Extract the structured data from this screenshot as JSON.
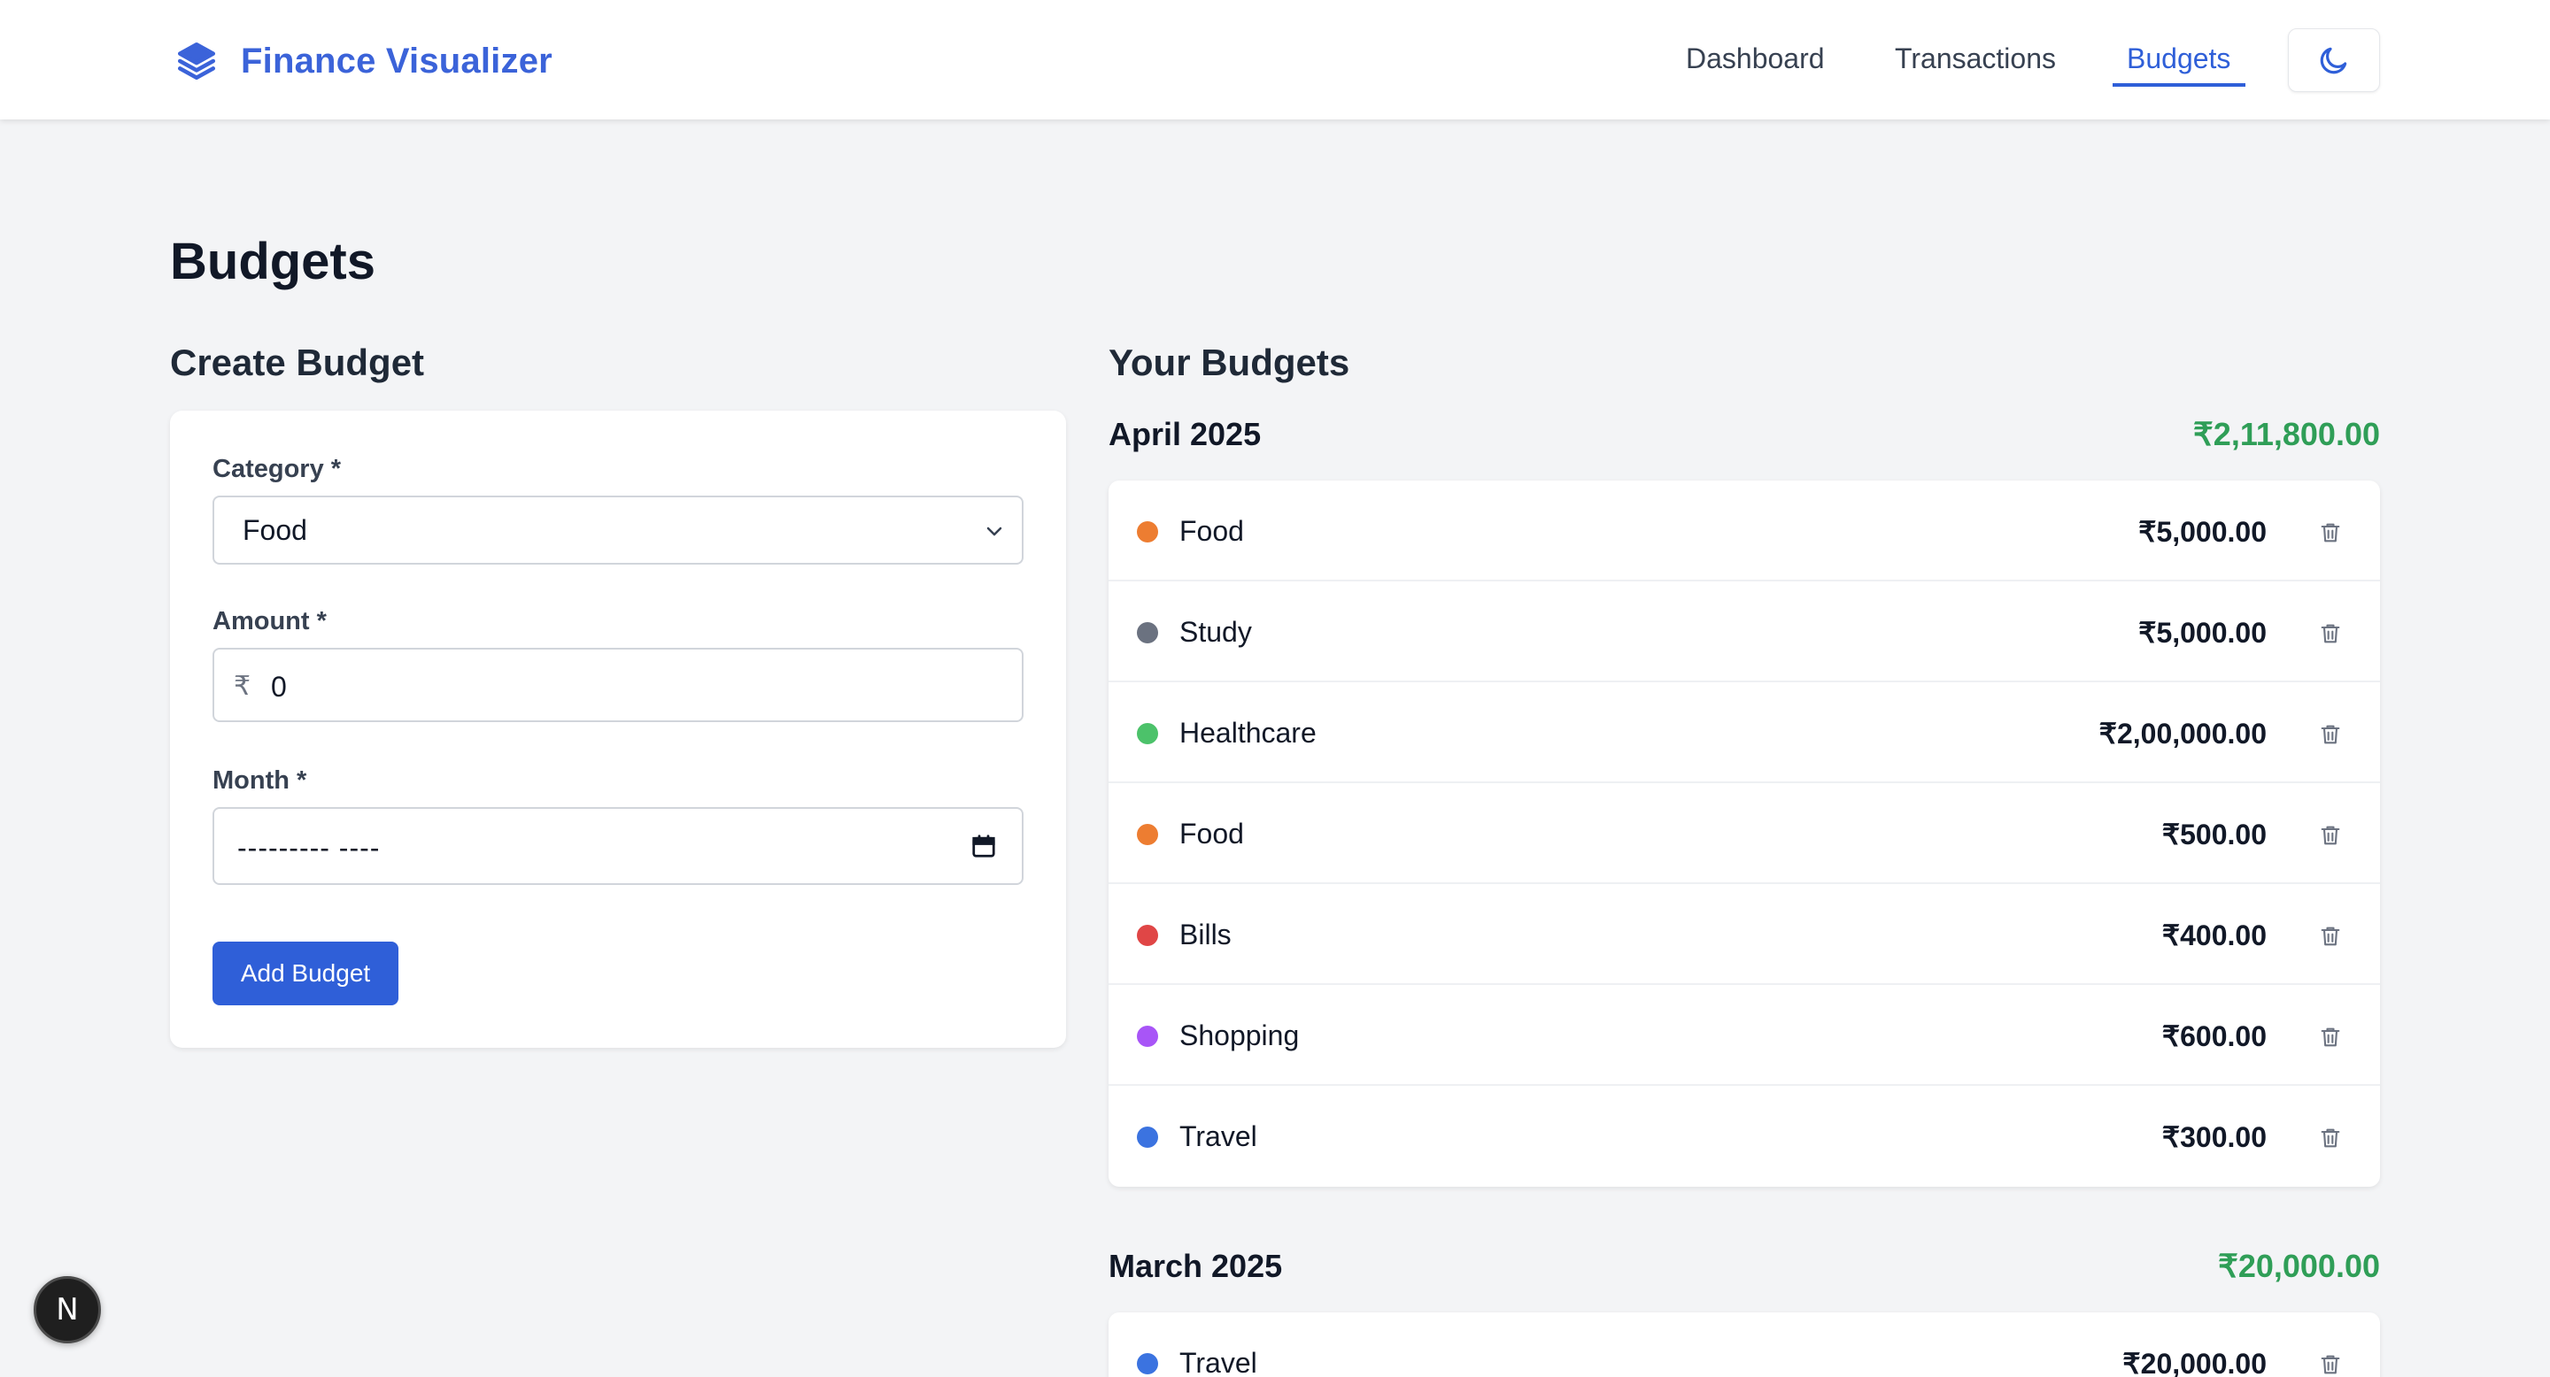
{
  "app": {
    "title": "Finance Visualizer",
    "accent_color": "#2f5fd8"
  },
  "nav": {
    "items": [
      {
        "label": "Dashboard",
        "active": false
      },
      {
        "label": "Transactions",
        "active": false
      },
      {
        "label": "Budgets",
        "active": true
      }
    ],
    "theme_toggle_icon": "moon-icon"
  },
  "page": {
    "title": "Budgets"
  },
  "create_budget": {
    "title": "Create Budget",
    "category_label": "Category *",
    "category_value": "Food",
    "amount_label": "Amount *",
    "currency_symbol": "₹",
    "amount_value": "0",
    "month_label": "Month *",
    "month_value": "--------- ----",
    "submit_label": "Add Budget"
  },
  "your_budgets": {
    "title": "Your Budgets",
    "months": [
      {
        "name": "April 2025",
        "total": "₹2,11,800.00",
        "items": [
          {
            "category": "Food",
            "amount": "₹5,000.00",
            "color": "#ed7d31"
          },
          {
            "category": "Study",
            "amount": "₹5,000.00",
            "color": "#6b7280"
          },
          {
            "category": "Healthcare",
            "amount": "₹2,00,000.00",
            "color": "#4cc26a"
          },
          {
            "category": "Food",
            "amount": "₹500.00",
            "color": "#ed7d31"
          },
          {
            "category": "Bills",
            "amount": "₹400.00",
            "color": "#e04646"
          },
          {
            "category": "Shopping",
            "amount": "₹600.00",
            "color": "#a855f7"
          },
          {
            "category": "Travel",
            "amount": "₹300.00",
            "color": "#3b73e0"
          }
        ]
      },
      {
        "name": "March 2025",
        "total": "₹20,000.00",
        "items": [
          {
            "category": "Travel",
            "amount": "₹20,000.00",
            "color": "#3b73e0"
          }
        ]
      }
    ]
  },
  "dev_badge": {
    "label": "N"
  }
}
